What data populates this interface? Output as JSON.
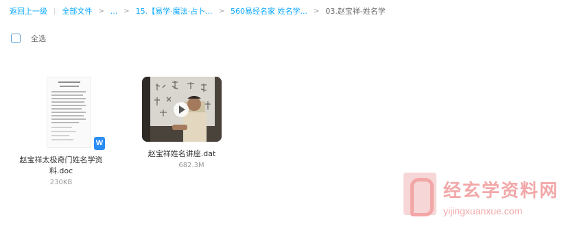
{
  "breadcrumb": {
    "back": "返回上一级",
    "items": [
      "全部文件",
      "...",
      "15.【易学·魔法·占卜...",
      "560易经名家 姓名学...",
      "03.赵宝祥-姓名学"
    ]
  },
  "toolbar": {
    "select_all": "全选"
  },
  "files": [
    {
      "name": "赵宝祥太极奇门姓名学资料.doc",
      "size": "230KB",
      "type_icon": "word-icon",
      "type_badge": "W",
      "badge_color": "#2b8cf4"
    },
    {
      "name": "赵宝祥姓名讲座.dat",
      "size": "682.3M",
      "type_icon": "video-play-icon"
    }
  ],
  "watermark": {
    "title": "经玄学资料网",
    "url": "yijingxuanxue.com"
  },
  "colors": {
    "accent": "#06a7ff",
    "watermark": "#f2a8a8"
  }
}
